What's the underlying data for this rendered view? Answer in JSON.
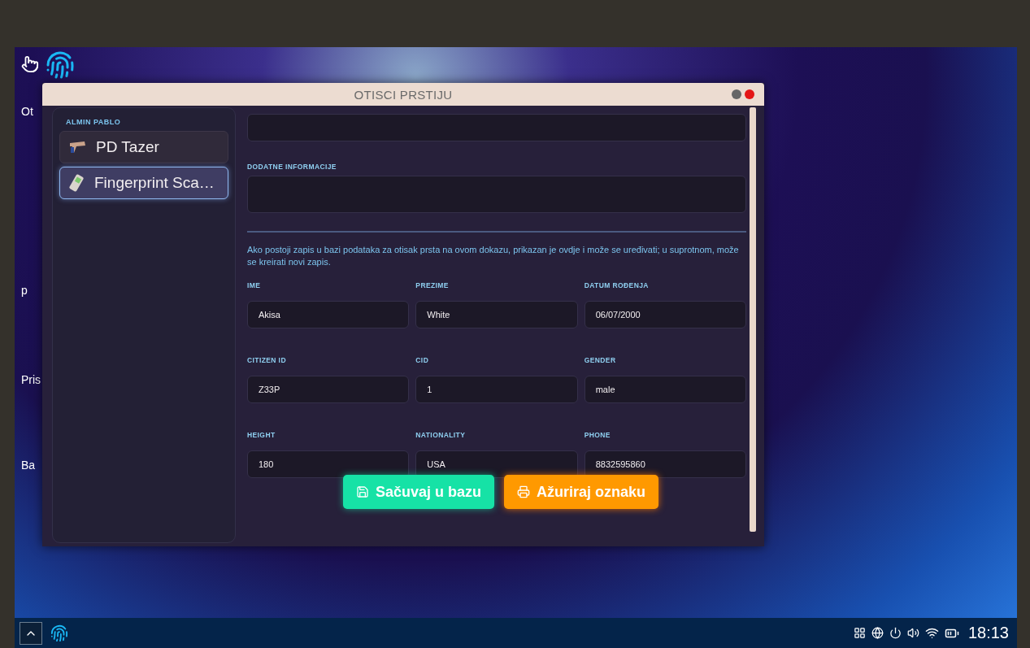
{
  "desktop": {
    "icons": [
      {
        "label": "Ot"
      },
      {
        "label": "p"
      },
      {
        "label": "Pris"
      },
      {
        "label": "Ba"
      }
    ]
  },
  "window": {
    "title": "OTISCI PRSTIJU"
  },
  "sidebar": {
    "heading": "ALMIN PABLO",
    "items": [
      {
        "label": "PD Tazer",
        "selected": false,
        "kind": "taser"
      },
      {
        "label": "Fingerprint Sca…",
        "selected": true,
        "kind": "scanner"
      }
    ]
  },
  "form": {
    "extra_label": "DODATNE INFORMACIJE",
    "note": "Ako postoji zapis u bazi podataka za otisak prsta na ovom dokazu, prikazan je ovdje i može se uređivati; u suprotnom, može se kreirati novi zapis.",
    "fields": [
      {
        "label": "IME",
        "value": "Akisa"
      },
      {
        "label": "PREZIME",
        "value": "White"
      },
      {
        "label": "DATUM ROĐENJA",
        "value": "06/07/2000"
      },
      {
        "label": "CITIZEN ID",
        "value": "Z33P"
      },
      {
        "label": "CID",
        "value": "1"
      },
      {
        "label": "GENDER",
        "value": "male"
      },
      {
        "label": "HEIGHT",
        "value": "180"
      },
      {
        "label": "NATIONALITY",
        "value": "USA"
      },
      {
        "label": "PHONE",
        "value": "8832595860"
      }
    ]
  },
  "buttons": [
    {
      "label": "Sačuvaj u bazu",
      "kind": "save"
    },
    {
      "label": "Ažuriraj oznaku",
      "kind": "print"
    }
  ],
  "taskbar": {
    "time": "18:13"
  }
}
